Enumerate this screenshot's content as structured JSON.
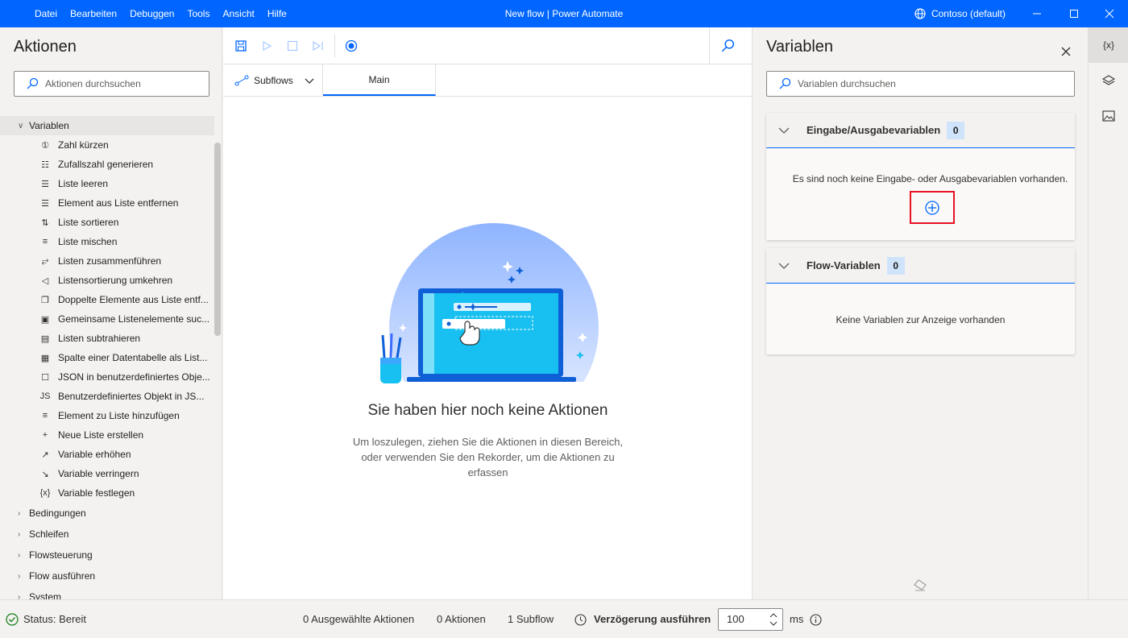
{
  "menu": [
    "Datei",
    "Bearbeiten",
    "Debuggen",
    "Tools",
    "Ansicht",
    "Hilfe"
  ],
  "window_title": "New flow | Power Automate",
  "environment": "Contoso (default)",
  "actions": {
    "title": "Aktionen",
    "search_placeholder": "Aktionen durchsuchen",
    "open_category": "Variablen",
    "items": [
      {
        "icon": "number-icon",
        "label": "Zahl kürzen"
      },
      {
        "icon": "random-icon",
        "label": "Zufallszahl generieren"
      },
      {
        "icon": "list-clear-icon",
        "label": "Liste leeren"
      },
      {
        "icon": "list-remove-icon",
        "label": "Element aus Liste entfernen"
      },
      {
        "icon": "sort-icon",
        "label": "Liste sortieren"
      },
      {
        "icon": "shuffle-icon",
        "label": "Liste mischen"
      },
      {
        "icon": "merge-icon",
        "label": "Listen zusammenführen"
      },
      {
        "icon": "reverse-icon",
        "label": "Listensortierung umkehren"
      },
      {
        "icon": "duplicate-icon",
        "label": "Doppelte Elemente aus Liste entf..."
      },
      {
        "icon": "common-icon",
        "label": "Gemeinsame Listenelemente suc..."
      },
      {
        "icon": "subtract-icon",
        "label": "Listen subtrahieren"
      },
      {
        "icon": "column-icon",
        "label": "Spalte einer Datentabelle als List..."
      },
      {
        "icon": "json-icon",
        "label": "JSON in benutzerdefiniertes Obje..."
      },
      {
        "icon": "js-icon",
        "label": "Benutzerdefiniertes Objekt in JS..."
      },
      {
        "icon": "list-add-icon",
        "label": "Element zu Liste hinzufügen"
      },
      {
        "icon": "plus-icon",
        "label": "Neue Liste erstellen"
      },
      {
        "icon": "increase-icon",
        "label": "Variable erhöhen"
      },
      {
        "icon": "decrease-icon",
        "label": "Variable verringern"
      },
      {
        "icon": "variable-icon",
        "label": "Variable festlegen"
      }
    ],
    "categories": [
      "Bedingungen",
      "Schleifen",
      "Flowsteuerung",
      "Flow ausführen",
      "System"
    ]
  },
  "canvas": {
    "subflows_label": "Subflows",
    "main_tab": "Main",
    "empty_title": "Sie haben hier noch keine Aktionen",
    "empty_desc": "Um loszulegen, ziehen Sie die Aktionen in diesen Bereich, oder verwenden Sie den Rekorder, um die Aktionen zu erfassen"
  },
  "variables": {
    "title": "Variablen",
    "search_placeholder": "Variablen durchsuchen",
    "io_title": "Eingabe/Ausgabevariablen",
    "io_count": "0",
    "io_empty": "Es sind noch keine Eingabe- oder Ausgabevariablen vorhanden.",
    "flow_title": "Flow-Variablen",
    "flow_count": "0",
    "flow_empty": "Keine Variablen zur Anzeige vorhanden"
  },
  "rail": {
    "variables_label": "{x}"
  },
  "status": {
    "state": "Status: Bereit",
    "selected": "0 Ausgewählte Aktionen",
    "actions": "0 Aktionen",
    "subflows": "1 Subflow",
    "delay_label": "Verzögerung ausführen",
    "delay_value": "100",
    "delay_unit": "ms"
  },
  "colors": {
    "accent": "#0066ff",
    "highlight": "#e81123"
  }
}
